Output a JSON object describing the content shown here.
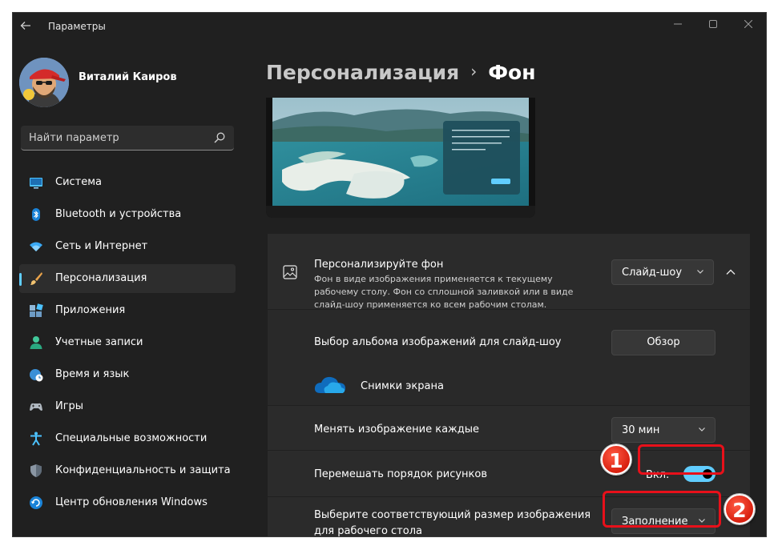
{
  "app": {
    "title": "Параметры"
  },
  "profile": {
    "name": "Виталий Каиров"
  },
  "search": {
    "placeholder": "Найти параметр"
  },
  "sidebar": {
    "items": [
      {
        "label": "Система",
        "icon": "display-icon"
      },
      {
        "label": "Bluetooth и устройства",
        "icon": "bluetooth-icon"
      },
      {
        "label": "Сеть и Интернет",
        "icon": "wifi-icon"
      },
      {
        "label": "Персонализация",
        "icon": "brush-icon",
        "active": true
      },
      {
        "label": "Приложения",
        "icon": "apps-icon"
      },
      {
        "label": "Учетные записи",
        "icon": "person-icon"
      },
      {
        "label": "Время и язык",
        "icon": "globe-clock-icon"
      },
      {
        "label": "Игры",
        "icon": "gamepad-icon"
      },
      {
        "label": "Специальные возможности",
        "icon": "accessibility-icon"
      },
      {
        "label": "Конфиденциальность и защита",
        "icon": "shield-icon"
      },
      {
        "label": "Центр обновления Windows",
        "icon": "update-icon"
      }
    ]
  },
  "breadcrumb": {
    "parent": "Персонализация",
    "separator": "›",
    "current": "Фон"
  },
  "background": {
    "title": "Персонализируйте фон",
    "description": "Фон в виде изображения применяется к текущему рабочему столу. Фон со сплошной заливкой или в виде слайд-шоу применяется ко всем рабочим столам.",
    "type_value": "Слайд-шоу"
  },
  "album": {
    "label": "Выбор альбома изображений для слайд-шоу",
    "browse_label": "Обзор",
    "folder_name": "Снимки экрана"
  },
  "interval": {
    "label": "Менять изображение каждые",
    "value": "30 мин"
  },
  "shuffle": {
    "label": "Перемешать порядок рисунков",
    "state_label": "Вкл.",
    "on": true
  },
  "fit": {
    "label": "Выберите соответствующий размер изображения для рабочего стола",
    "value": "Заполнение"
  },
  "annotations": {
    "badge1": "1",
    "badge2": "2",
    "color": "#e8101a"
  },
  "colors": {
    "accent": "#60cdff",
    "background": "#202020",
    "card": "#2b2b2b"
  }
}
